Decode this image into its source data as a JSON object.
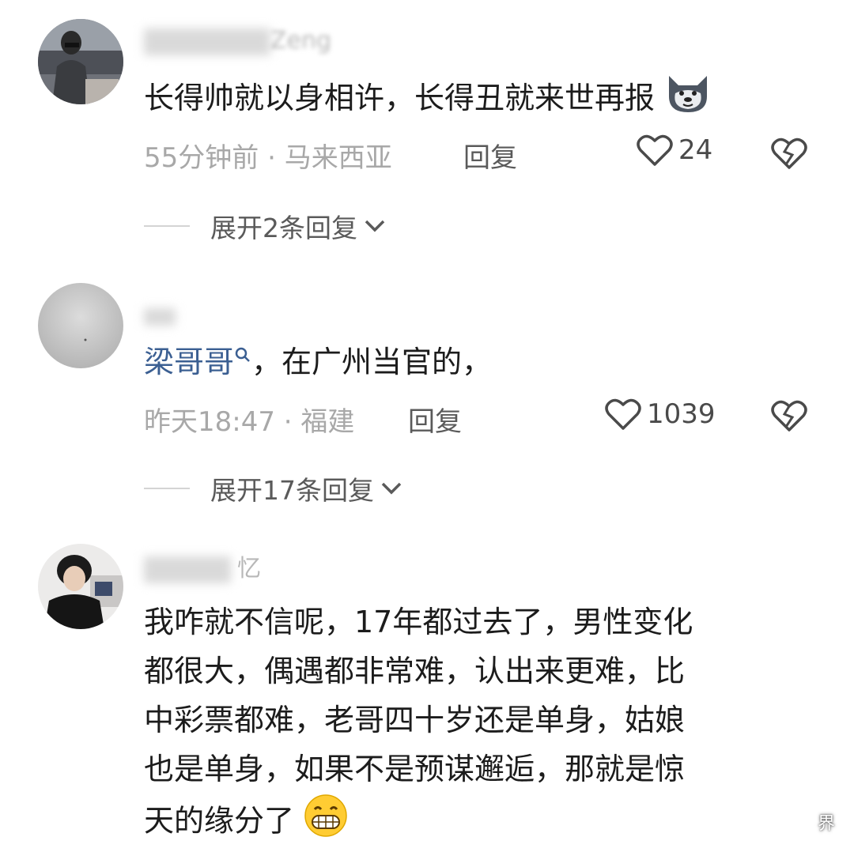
{
  "comments": [
    {
      "username_visible": "Zeng",
      "text": "长得帅就以身相许，长得丑就来世再报",
      "emoji": "doge-wolf-emoji",
      "time": "55分钟前",
      "location": "马来西亚",
      "reply_label": "回复",
      "likes": "24",
      "expand": "展开2条回复"
    },
    {
      "username_visible": "",
      "mention": "梁哥哥",
      "text": "，在广州当官的，",
      "time": "昨天18:47",
      "location": "福建",
      "reply_label": "回复",
      "likes": "1039",
      "expand": "展开17条回复"
    },
    {
      "username_visible": "忆",
      "text_lines": [
        "我咋就不信呢，17年都过去了，男性变化",
        "都很大，偶遇都非常难，认出来更难，比",
        "中彩票都难，老哥四十岁还是单身，姑娘",
        "也是单身，如果不是预谋邂逅，那就是惊",
        "天的缘分了"
      ],
      "emoji": "grinning-emoji"
    }
  ],
  "separator": " · ",
  "colors": {
    "text": "#1c1c1c",
    "meta": "#a8a8a8",
    "mention": "#3b5f92",
    "background": "#ffffff"
  },
  "watermark": "界"
}
